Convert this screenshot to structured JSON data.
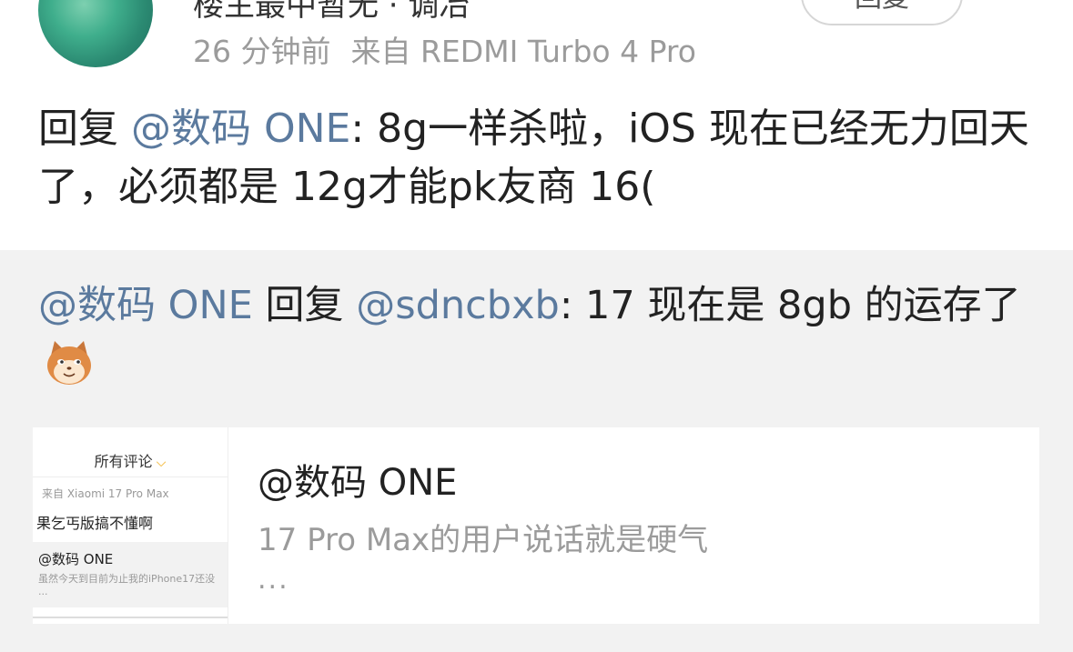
{
  "post": {
    "username": "楼主最中暂无 · 调冶",
    "follow_label": "回复",
    "time": "26 分钟前",
    "source": "来自 REDMI Turbo 4 Pro",
    "reply_prefix": "回复 ",
    "reply_mention": "@数码 ONE",
    "reply_body": ": 8g一样杀啦，iOS 现在已经无力回天了，必须都是 12g才能pk友商 16("
  },
  "quote": {
    "mention_author": "@数码 ONE",
    "reply_word": " 回复 ",
    "mention_target": "@sdncbxb",
    "body": ": 17 现在是 8gb 的运存了",
    "emoji": "cat-face-icon"
  },
  "card": {
    "thumb": {
      "header": "所有评论",
      "meta": "来自 Xiaomi 17 Pro Max",
      "title": "果乞丐版搞不懂啊",
      "quote_name": "@数码 ONE",
      "quote_body": "虽然今天到目前为止我的iPhone17还没",
      "quote_more": "..."
    },
    "title": "@数码 ONE",
    "description": "17 Pro Max的用户说话就是硬气",
    "ellipsis": "..."
  },
  "colors": {
    "mention": "#5b7a9e",
    "secondary_text": "#9b9b9b",
    "quote_bg": "#f2f2f2"
  }
}
